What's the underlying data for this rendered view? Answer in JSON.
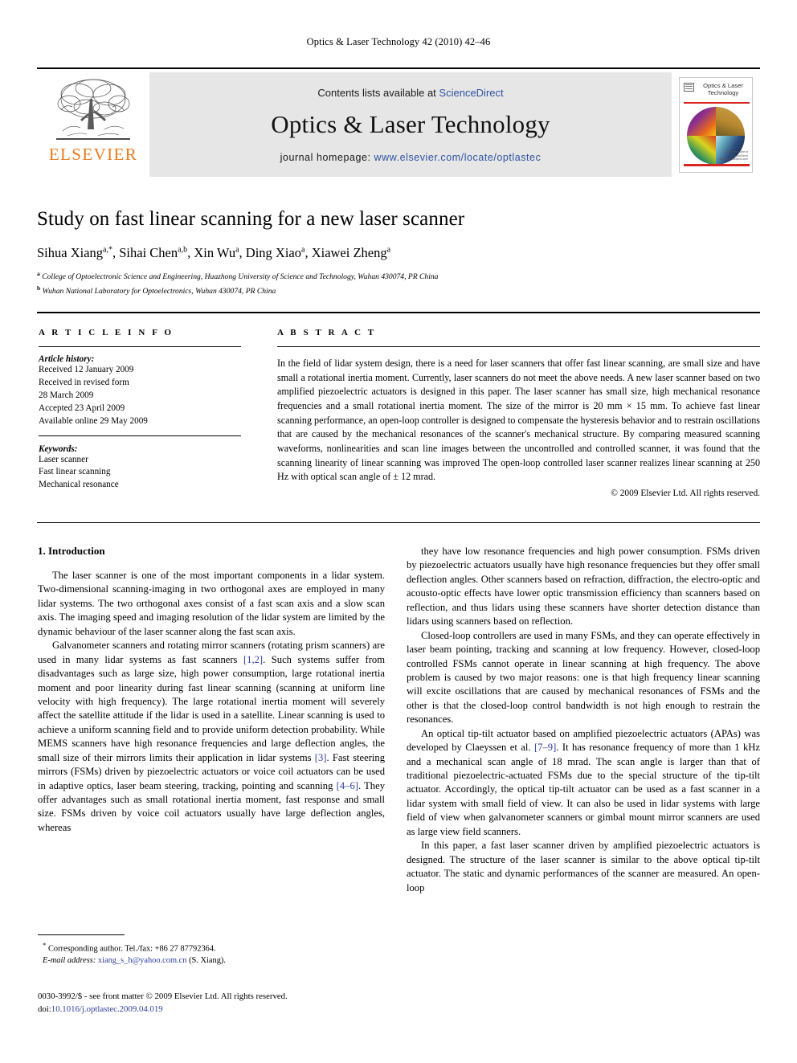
{
  "running_head": "Optics & Laser Technology 42 (2010) 42–46",
  "masthead": {
    "publisher_name": "ELSEVIER",
    "publisher_logo_icon": "elsevier-tree-icon",
    "contents_prefix": "Contents lists available at",
    "contents_link": "ScienceDirect",
    "journal_name": "Optics & Laser Technology",
    "homepage_prefix": "journal homepage:",
    "homepage_link": "www.elsevier.com/locate/optlastec",
    "cover": {
      "title_line1": "Optics & Laser",
      "title_line2": "Technology",
      "logo_icon": "journal-emblem-icon",
      "credit_line1": "Available online at",
      "credit_line2": "ScienceDirect",
      "credit_line3": "www.sciencedirect.com"
    }
  },
  "article": {
    "title": "Study on fast linear scanning for a new laser scanner",
    "authors": [
      {
        "name": "Sihua Xiang",
        "marks": "a,*"
      },
      {
        "name": "Sihai Chen",
        "marks": "a,b"
      },
      {
        "name": "Xin Wu",
        "marks": "a"
      },
      {
        "name": "Ding Xiao",
        "marks": "a"
      },
      {
        "name": "Xiawei Zheng",
        "marks": "a"
      }
    ],
    "affiliations": [
      {
        "mark": "a",
        "text": "College of Optoelectronic Science and Engineering, Huazhong University of Science and Technology, Wuhan 430074, PR China"
      },
      {
        "mark": "b",
        "text": "Wuhan National Laboratory for Optoelectronics, Wuhan 430074, PR China"
      }
    ]
  },
  "article_info": {
    "heading": "A R T I C L E   I N F O",
    "history_label": "Article history:",
    "history_lines": [
      "Received 12 January 2009",
      "Received in revised form",
      "28 March 2009",
      "Accepted 23 April 2009",
      "Available online 29 May 2009"
    ],
    "keywords_label": "Keywords:",
    "keywords": [
      "Laser scanner",
      "Fast linear scanning",
      "Mechanical resonance"
    ]
  },
  "abstract": {
    "heading": "A B S T R A C T",
    "text": "In the field of lidar system design, there is a need for laser scanners that offer fast linear scanning, are small size and have small a rotational inertia moment. Currently, laser scanners do not meet the above needs. A new laser scanner based on two amplified piezoelectric actuators is designed in this paper. The laser scanner has small size, high mechanical resonance frequencies and a small rotational inertia moment. The size of the mirror is 20 mm × 15 mm. To achieve fast linear scanning performance, an open-loop controller is designed to compensate the hysteresis behavior and to restrain oscillations that are caused by the mechanical resonances of the scanner's mechanical structure. By comparing measured scanning waveforms, nonlinearities and scan line images between the uncontrolled and controlled scanner, it was found that the scanning linearity of linear scanning was improved The open-loop controlled laser scanner realizes linear scanning at 250 Hz with optical scan angle of ± 12 mrad.",
    "copyright": "© 2009 Elsevier Ltd. All rights reserved."
  },
  "body": {
    "section_number_title": "1.  Introduction",
    "left_paragraphs": [
      "The laser scanner is one of the most important components in a lidar system. Two-dimensional scanning-imaging in two orthogonal axes are employed in many lidar systems. The two orthogonal axes consist of a fast scan axis and a slow scan axis. The imaging speed and imaging resolution of the lidar system are limited by the dynamic behaviour of the laser scanner along the fast scan axis.",
      "Galvanometer scanners and rotating mirror scanners (rotating prism scanners) are used in many lidar systems as fast scanners [1,2]. Such systems suffer from disadvantages such as large size, high power consumption, large rotational inertia moment and poor linearity during fast linear scanning (scanning at uniform line velocity with high frequency). The large rotational inertia moment will severely affect the satellite attitude if the lidar is used in a satellite. Linear scanning is used to achieve a uniform scanning field and to provide uniform detection probability. While MEMS scanners have high resonance frequencies and large deflection angles, the small size of their mirrors limits their application in lidar systems [3]. Fast steering mirrors (FSMs) driven by piezoelectric actuators or voice coil actuators can be used in adaptive optics, laser beam steering, tracking, pointing and scanning [4–6]. They offer advantages such as small rotational inertia moment, fast response and small size. FSMs driven by voice coil actuators usually have large deflection angles, whereas"
    ],
    "right_paragraphs": [
      "they have low resonance frequencies and high power consumption. FSMs driven by piezoelectric actuators usually have high resonance frequencies but they offer small deflection angles. Other scanners based on refraction, diffraction, the electro-optic and acousto-optic effects have lower optic transmission efficiency than scanners based on reflection, and thus lidars using these scanners have shorter detection distance than lidars using scanners based on reflection.",
      "Closed-loop controllers are used in many FSMs, and they can operate effectively in laser beam pointing, tracking and scanning at low frequency. However, closed-loop controlled FSMs cannot operate in linear scanning at high frequency. The above problem is caused by two major reasons: one is that high frequency linear scanning will excite oscillations that are caused by mechanical resonances of FSMs and the other is that the closed-loop control bandwidth is not high enough to restrain the resonances.",
      "An optical tip-tilt actuator based on amplified piezoelectric actuators (APAs) was developed by Claeyssen et al. [7–9]. It has resonance frequency of more than 1 kHz and a mechanical scan angle of 18 mrad. The scan angle is larger than that of traditional piezoelectric-actuated FSMs due to the special structure of the tip-tilt actuator. Accordingly, the optical tip-tilt actuator can be used as a fast scanner in a lidar system with small field of view. It can also be used in lidar systems with large field of view when galvanometer scanners or gimbal mount mirror scanners are used as large view field scanners.",
      "In this paper, a fast laser scanner driven by amplified piezoelectric actuators is designed. The structure of the laser scanner is similar to the above optical tip-tilt actuator. The static and dynamic performances of the scanner are measured. An open-loop"
    ],
    "citations": [
      "[1,2]",
      "[3]",
      "[4–6]",
      "[7–9]"
    ]
  },
  "footnotes": {
    "corresponding_marker": "*",
    "corresponding_text": "Corresponding author. Tel./fax: +86 27 87792364.",
    "email_label": "E-mail address:",
    "email_address": "xiang_s_h@yahoo.com.cn",
    "email_owner": "(S. Xiang).",
    "imprint_line1": "0030-3992/$ - see front matter © 2009 Elsevier Ltd. All rights reserved.",
    "imprint_doi_label": "doi:",
    "imprint_doi": "10.1016/j.optlastec.2009.04.019"
  },
  "colors": {
    "link_blue": "#2f52a0",
    "ref_blue": "#2f3f9e",
    "elsevier_orange": "#E87B1E",
    "banner_grey": "#e6e6e6",
    "cover_red": "#d8251f"
  }
}
